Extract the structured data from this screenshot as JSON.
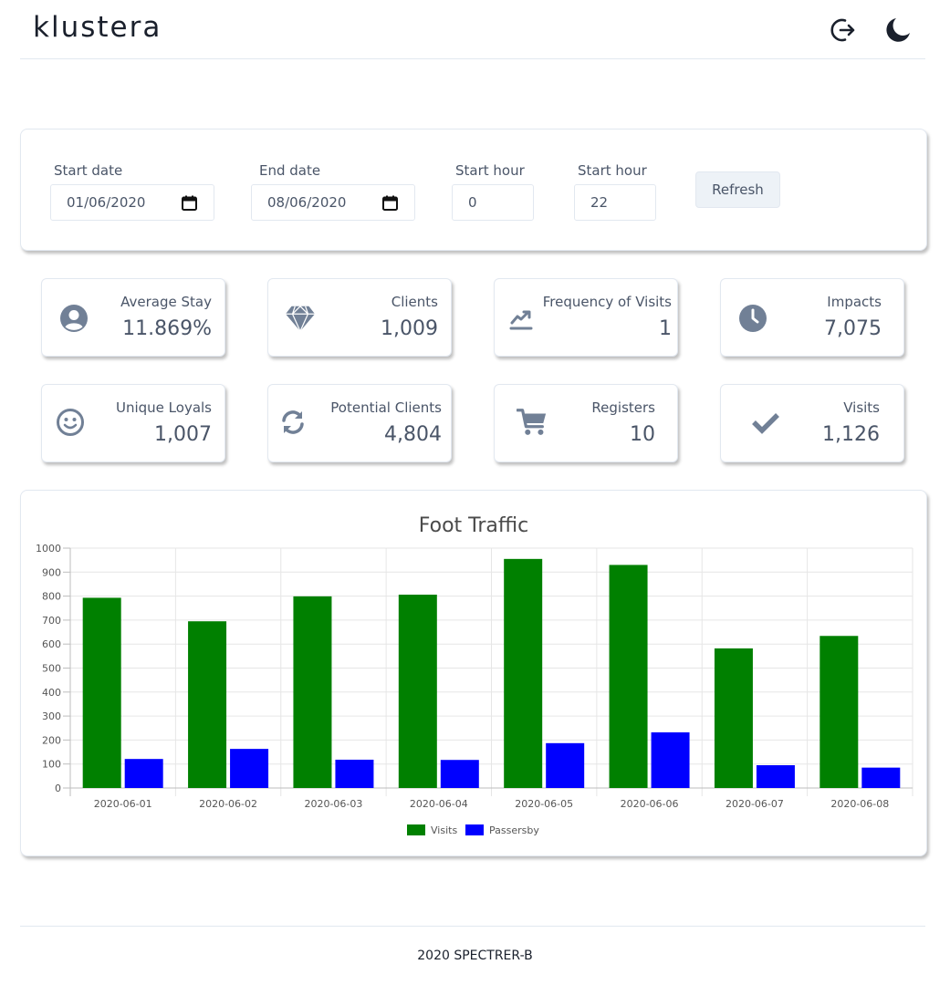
{
  "app": {
    "logo": "klustera"
  },
  "header": {
    "logout_icon": "logout-icon",
    "theme_icon": "moon-icon"
  },
  "filters": {
    "start_date": {
      "label": "Start date",
      "value": "01/06/2020"
    },
    "end_date": {
      "label": "End date",
      "value": "08/06/2020"
    },
    "start_hour": {
      "label": "Start hour",
      "value": "0"
    },
    "end_hour": {
      "label": "Start hour",
      "value": "22"
    },
    "refresh_label": "Refresh"
  },
  "stats": [
    {
      "title": "Average Stay",
      "value": "11.869%",
      "icon": "user-circle-icon"
    },
    {
      "title": "Clients",
      "value": "1,009",
      "icon": "diamond-icon"
    },
    {
      "title": "Frequency of Visits",
      "value": "1",
      "icon": "chart-line-icon"
    },
    {
      "title": "Impacts",
      "value": "7,075",
      "icon": "clock-icon"
    },
    {
      "title": "Unique Loyals",
      "value": "1,007",
      "icon": "smile-icon"
    },
    {
      "title": "Potential Clients",
      "value": "4,804",
      "icon": "refresh-icon"
    },
    {
      "title": "Registers",
      "value": "10",
      "icon": "cart-icon"
    },
    {
      "title": "Visits",
      "value": "1,126",
      "icon": "check-icon"
    }
  ],
  "chart_data": {
    "type": "bar",
    "title": "Foot Traffic",
    "categories": [
      "2020-06-01",
      "2020-06-02",
      "2020-06-03",
      "2020-06-04",
      "2020-06-05",
      "2020-06-06",
      "2020-06-07",
      "2020-06-08"
    ],
    "series": [
      {
        "name": "Visits",
        "color": "#008000",
        "values": [
          793,
          695,
          799,
          806,
          955,
          930,
          582,
          634
        ]
      },
      {
        "name": "Passersby",
        "color": "#0000ff",
        "values": [
          121,
          163,
          118,
          117,
          187,
          232,
          95,
          85
        ]
      }
    ],
    "ylim": [
      0,
      1000
    ],
    "yticks": [
      "0",
      "100",
      "200",
      "300",
      "400",
      "500",
      "600",
      "700",
      "800",
      "900",
      "1000"
    ],
    "grid": true,
    "legend": "bottom"
  },
  "footer": {
    "text": "2020 SPECTRER-B"
  }
}
